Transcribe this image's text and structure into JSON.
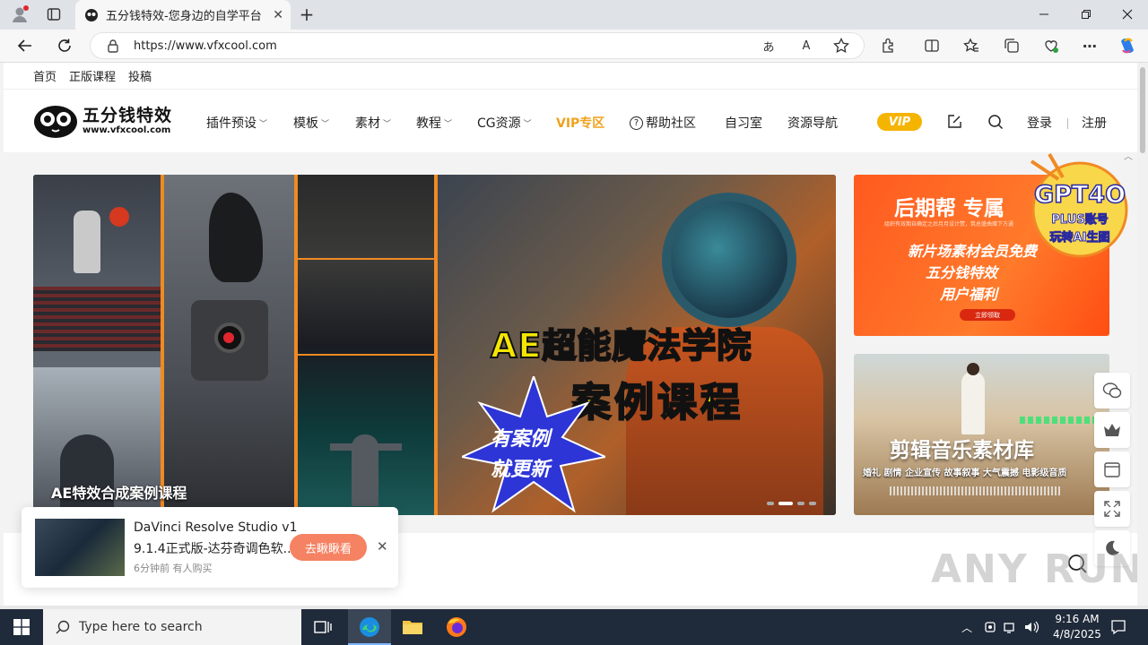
{
  "browser": {
    "tab_title": "五分钱特效-您身边的自学平台",
    "new_tab": "+",
    "url": "https://www.vfxcool.com",
    "window_controls": [
      "minimize",
      "restore",
      "close"
    ]
  },
  "site": {
    "top_links": [
      "首页",
      "正版课程",
      "投稿"
    ],
    "logo_text": "五分钱特效",
    "logo_sub": "www.vfxcool.com",
    "nav": [
      {
        "label": "插件预设",
        "dropdown": true
      },
      {
        "label": "模板",
        "dropdown": true
      },
      {
        "label": "素材",
        "dropdown": true
      },
      {
        "label": "教程",
        "dropdown": true
      },
      {
        "label": "CG资源",
        "dropdown": true
      },
      {
        "label": "VIP专区",
        "dropdown": false
      },
      {
        "label": "帮助社区",
        "dropdown": false
      },
      {
        "label": "自习室",
        "dropdown": false
      },
      {
        "label": "资源导航",
        "dropdown": false
      }
    ],
    "vip_badge": "VIP",
    "login": "登录",
    "register": "注册",
    "accent_color": "#f5a623",
    "vip_color": "#f0a21e"
  },
  "banner": {
    "headline_1": "AE超能魔法学院",
    "headline_2": "案例课程",
    "star_text_1": "有案例",
    "star_text_2": "就更新",
    "caption": "AE特效合成案例课程"
  },
  "side_banner_1": {
    "title": "后期帮 专属",
    "small": "组织有效期自确定之后月月设计赞，筑总盛曲赠下方通",
    "line1": "新片场素材会员免费",
    "line2": "五分钱特效",
    "line3": "用户福利",
    "button": "立即领取"
  },
  "promo_badge": {
    "line1": "GPT4O",
    "line2": "PLUS账号",
    "line3": "玩转AI生图"
  },
  "side_banner_2": {
    "title": "剪辑音乐素材库",
    "tags": "婚礼 剧情 企业宣传 故事叙事 大气震撼 电影级音质"
  },
  "toast": {
    "title_line1": "DaVinci Resolve Studio v1",
    "title_line2": "9.1.4正式版-达芬奇调色软...",
    "meta": "6分钟前 有人购买",
    "button": "去瞅瞅看"
  },
  "watermark": "ANY RUN",
  "taskbar": {
    "search_placeholder": "Type here to search",
    "time": "9:16 AM",
    "date": "4/8/2025"
  }
}
